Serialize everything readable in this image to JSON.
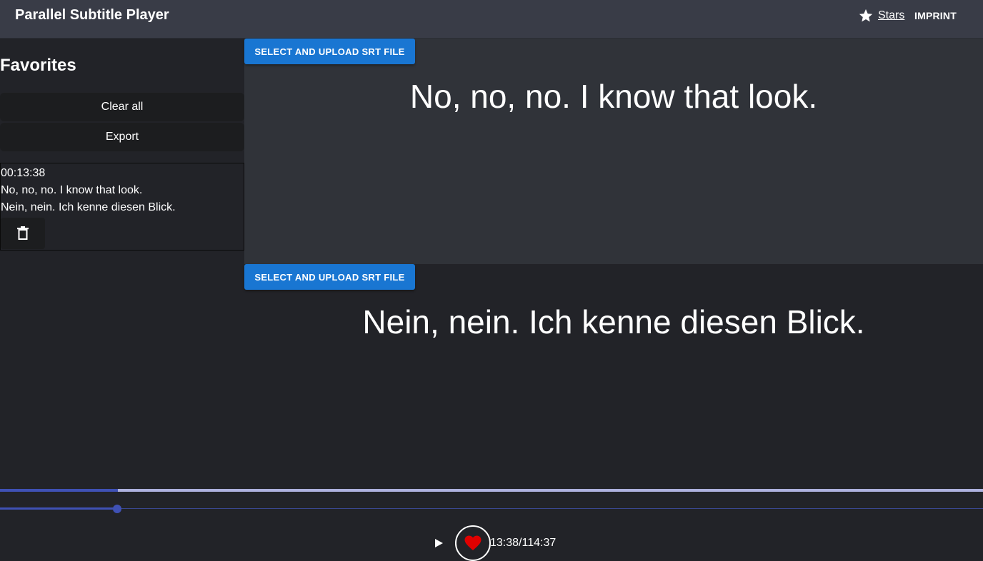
{
  "header": {
    "title": "Parallel Subtitle Player",
    "stars_label": "Stars",
    "imprint_label": "IMPRINT"
  },
  "sidebar": {
    "heading": "Favorites",
    "clear_all_label": "Clear all",
    "export_label": "Export",
    "favorites": [
      {
        "timestamp": "00:13:38",
        "line_1": "No, no, no. I know that look.",
        "line_2": "Nein, nein. Ich kenne diesen Blick.",
        "delete_icon": "trash-icon"
      }
    ]
  },
  "panes": {
    "top": {
      "upload_label": "SELECT AND UPLOAD SRT FILE",
      "subtitle": "No, no, no. I know that look."
    },
    "bottom": {
      "upload_label": "SELECT AND UPLOAD SRT FILE",
      "subtitle": "Nein, nein. Ich kenne diesen Blick."
    }
  },
  "player": {
    "progress_fraction": 0.1189,
    "current_time": "13:38",
    "total_time": "114:37",
    "time_display": "13:38/114:37",
    "play_icon": "play-icon",
    "favorite_icon": "heart-icon"
  },
  "colors": {
    "header_bg": "#393c47",
    "page_bg": "#222328",
    "top_pane_bg": "#303339",
    "accent_blue": "#1976d2",
    "progress": "#3f51b5",
    "progress_track": "#aeb1de",
    "heart": "#e00000"
  }
}
